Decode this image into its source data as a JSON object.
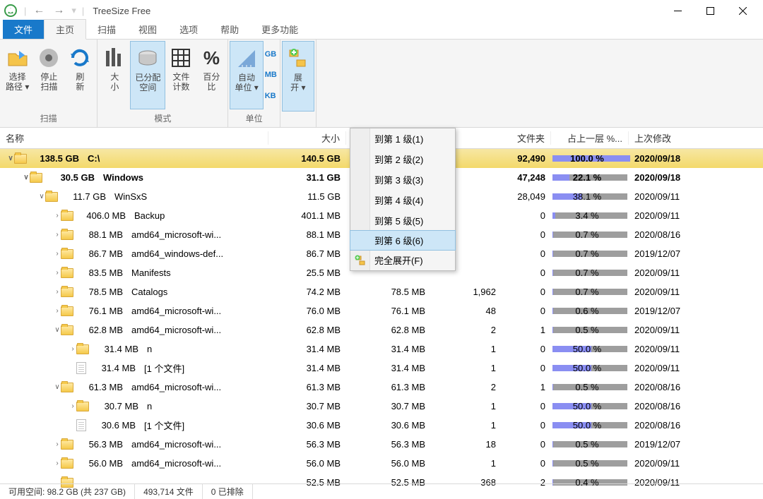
{
  "title": "TreeSize Free",
  "menu": {
    "file": "文件",
    "home": "主页",
    "scan": "扫描",
    "view": "视图",
    "options": "选项",
    "help": "帮助",
    "more": "更多功能"
  },
  "ribbon": {
    "scan_group": "扫描",
    "select_path": "选择\n路径 ▾",
    "stop_scan": "停止\n扫描",
    "refresh": "刷\n新",
    "mode_group": "模式",
    "size": "大\n小",
    "allocated": "已分配\n空间",
    "file_count": "文件\n计数",
    "percent": "百分\n比",
    "unit_group": "单位",
    "auto_unit": "自动\n单位 ▾",
    "gb": "GB",
    "mb": "MB",
    "kb": "KB",
    "expand": "展\n开 ▾"
  },
  "headers": {
    "name": "名称",
    "size": "大小",
    "files": "文件夹",
    "pct": "占上一层 %...",
    "date": "上次修改"
  },
  "dropdown": {
    "lvl1": "到第 1 级(1)",
    "lvl2": "到第 2 级(2)",
    "lvl3": "到第 3 级(3)",
    "lvl4": "到第 4 级(4)",
    "lvl5": "到第 5 级(5)",
    "lvl6": "到第 6 级(6)",
    "full": "完全展开(F)"
  },
  "rows": [
    {
      "indent": 0,
      "exp": "∨",
      "sel": true,
      "bold": true,
      "icon": "folder",
      "nsize": "138.5 GB",
      "nsizew": 66,
      "name": "C:\\",
      "size": "140.5 GB",
      "alloc": "",
      "files": "",
      "folders": "92,490",
      "pct": 100.0,
      "pct_txt": "100.0 %",
      "date": "2020/09/18"
    },
    {
      "indent": 1,
      "exp": "∨",
      "bold": true,
      "icon": "folder",
      "nsize": "30.5 GB",
      "nsizew": 66,
      "name": "Windows",
      "size": "31.1 GB",
      "alloc": "",
      "files": "",
      "folders": "47,248",
      "pct": 22.1,
      "pct_txt": "22.1 %",
      "date": "2020/09/18"
    },
    {
      "indent": 2,
      "exp": "∨",
      "icon": "folder",
      "nsize": "11.7 GB",
      "nsizew": 60,
      "name": "WinSxS",
      "size": "11.5 GB",
      "alloc": "",
      "files": "",
      "folders": "28,049",
      "pct": 38.1,
      "pct_txt": "38.1 %",
      "date": "2020/09/11"
    },
    {
      "indent": 3,
      "exp": "›",
      "icon": "folder",
      "nsize": "406.0 MB",
      "nsizew": 66,
      "name": "Backup",
      "size": "401.1 MB",
      "alloc": "",
      "files": "",
      "folders": "0",
      "pct": 3.4,
      "pct_txt": "3.4 %",
      "date": "2020/09/11"
    },
    {
      "indent": 3,
      "exp": "›",
      "icon": "folder",
      "nsize": "88.1 MB",
      "nsizew": 62,
      "name": "amd64_microsoft-wi...",
      "size": "88.1 MB",
      "alloc": "",
      "files": "",
      "folders": "0",
      "pct": 0.7,
      "pct_txt": "0.7 %",
      "date": "2020/08/16"
    },
    {
      "indent": 3,
      "exp": "›",
      "icon": "folder",
      "nsize": "86.7 MB",
      "nsizew": 62,
      "name": "amd64_windows-def...",
      "size": "86.7 MB",
      "alloc": "",
      "files": "",
      "folders": "0",
      "pct": 0.7,
      "pct_txt": "0.7 %",
      "date": "2019/12/07"
    },
    {
      "indent": 3,
      "exp": "›",
      "icon": "folder",
      "nsize": "83.5 MB",
      "nsizew": 62,
      "name": "Manifests",
      "size": "25.5 MB",
      "alloc": "",
      "files": "",
      "folders": "0",
      "pct": 0.7,
      "pct_txt": "0.7 %",
      "date": "2020/09/11"
    },
    {
      "indent": 3,
      "exp": "›",
      "icon": "folder",
      "nsize": "78.5 MB",
      "nsizew": 62,
      "name": "Catalogs",
      "size": "74.2 MB",
      "alloc": "78.5 MB",
      "files": "1,962",
      "folders": "0",
      "pct": 0.7,
      "pct_txt": "0.7 %",
      "date": "2020/09/11"
    },
    {
      "indent": 3,
      "exp": "›",
      "icon": "folder",
      "nsize": "76.1 MB",
      "nsizew": 62,
      "name": "amd64_microsoft-wi...",
      "size": "76.0 MB",
      "alloc": "76.1 MB",
      "files": "48",
      "folders": "0",
      "pct": 0.6,
      "pct_txt": "0.6 %",
      "date": "2019/12/07"
    },
    {
      "indent": 3,
      "exp": "∨",
      "icon": "folder",
      "nsize": "62.8 MB",
      "nsizew": 62,
      "name": "amd64_microsoft-wi...",
      "size": "62.8 MB",
      "alloc": "62.8 MB",
      "files": "2",
      "folders": "1",
      "pct": 0.5,
      "pct_txt": "0.5 %",
      "date": "2020/09/11"
    },
    {
      "indent": 4,
      "exp": "›",
      "icon": "folder",
      "nsize": "31.4 MB",
      "nsizew": 62,
      "name": "n",
      "size": "31.4 MB",
      "alloc": "31.4 MB",
      "files": "1",
      "folders": "0",
      "pct": 50.0,
      "pct_txt": "50.0 %",
      "date": "2020/09/11"
    },
    {
      "indent": 4,
      "exp": "",
      "icon": "file",
      "nsize": "31.4 MB",
      "nsizew": 62,
      "name": "[1 个文件]",
      "size": "31.4 MB",
      "alloc": "31.4 MB",
      "files": "1",
      "folders": "0",
      "pct": 50.0,
      "pct_txt": "50.0 %",
      "date": "2020/09/11"
    },
    {
      "indent": 3,
      "exp": "∨",
      "icon": "folder",
      "nsize": "61.3 MB",
      "nsizew": 62,
      "name": "amd64_microsoft-wi...",
      "size": "61.3 MB",
      "alloc": "61.3 MB",
      "files": "2",
      "folders": "1",
      "pct": 0.5,
      "pct_txt": "0.5 %",
      "date": "2020/08/16"
    },
    {
      "indent": 4,
      "exp": "›",
      "icon": "folder",
      "nsize": "30.7 MB",
      "nsizew": 62,
      "name": "n",
      "size": "30.7 MB",
      "alloc": "30.7 MB",
      "files": "1",
      "folders": "0",
      "pct": 50.0,
      "pct_txt": "50.0 %",
      "date": "2020/08/16"
    },
    {
      "indent": 4,
      "exp": "",
      "icon": "file",
      "nsize": "30.6 MB",
      "nsizew": 62,
      "name": "[1 个文件]",
      "size": "30.6 MB",
      "alloc": "30.6 MB",
      "files": "1",
      "folders": "0",
      "pct": 50.0,
      "pct_txt": "50.0 %",
      "date": "2020/08/16"
    },
    {
      "indent": 3,
      "exp": "›",
      "icon": "folder",
      "nsize": "56.3 MB",
      "nsizew": 62,
      "name": "amd64_microsoft-wi...",
      "size": "56.3 MB",
      "alloc": "56.3 MB",
      "files": "18",
      "folders": "0",
      "pct": 0.5,
      "pct_txt": "0.5 %",
      "date": "2019/12/07"
    },
    {
      "indent": 3,
      "exp": "›",
      "icon": "folder",
      "nsize": "56.0 MB",
      "nsizew": 62,
      "name": "amd64_microsoft-wi...",
      "size": "56.0 MB",
      "alloc": "56.0 MB",
      "files": "1",
      "folders": "0",
      "pct": 0.5,
      "pct_txt": "0.5 %",
      "date": "2020/09/11"
    },
    {
      "indent": 3,
      "exp": "",
      "icon": "folder",
      "nsize": "",
      "nsizew": 0,
      "name": "",
      "size": "52.5 MB",
      "alloc": "52.5 MB",
      "files": "368",
      "folders": "2",
      "pct": 0.4,
      "pct_txt": "0.4 %",
      "date": "2020/09/11"
    }
  ],
  "status": {
    "free": "可用空间: 98.2 GB  (共 237 GB)",
    "files": "493,714 文件",
    "excluded": "0 已排除"
  }
}
